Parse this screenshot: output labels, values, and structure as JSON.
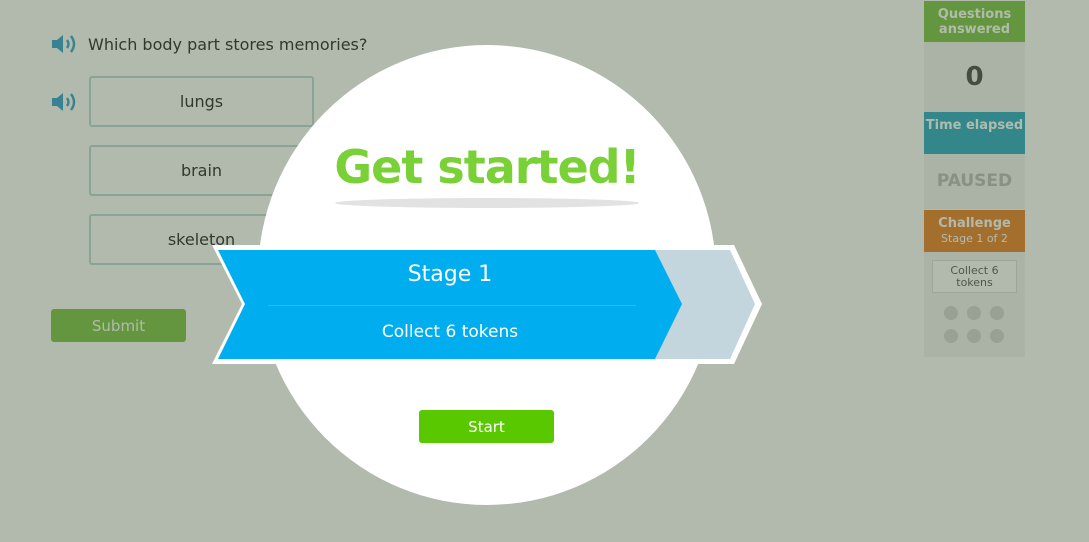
{
  "question": {
    "text": "Which body part stores memories?",
    "answers": [
      "lungs",
      "brain",
      "skeleton"
    ],
    "submit_label": "Submit"
  },
  "sidebar": {
    "questions_answered_label": "Questions answered",
    "questions_answered_value": "0",
    "time_elapsed_label": "Time elapsed",
    "time_elapsed_value": "PAUSED",
    "challenge_label": "Challenge",
    "challenge_stage": "Stage 1 of 2",
    "tokens_label": "Collect 6 tokens",
    "tokens_total": 6,
    "tokens_collected": 0
  },
  "overlay": {
    "title": "Get started!",
    "stage_label": "Stage 1",
    "goal_label": "Collect 6 tokens",
    "start_label": "Start"
  },
  "colors": {
    "green": "#7ac142",
    "blue": "#27a7c4",
    "orange": "#e97c24",
    "banner_blue": "#00aef0",
    "start_green": "#5ac800"
  },
  "icons": [
    "speaker-icon"
  ]
}
